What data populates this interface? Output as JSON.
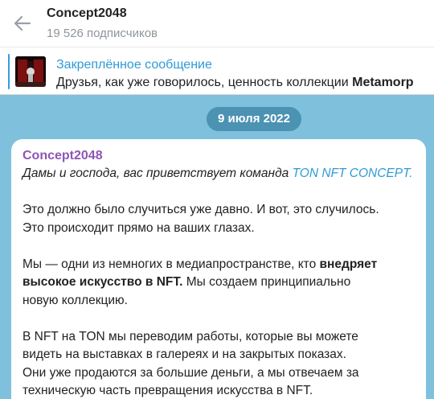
{
  "header": {
    "title": "Concept2048",
    "subscribers": "19 526 подписчиков",
    "back_icon": "arrow-left-icon"
  },
  "pinned": {
    "title": "Закреплённое сообщение",
    "text_prefix": "Друзья, как уже говорилось, ценность коллекции ",
    "text_bold": "Metamorp",
    "accent": "#3a9bdc"
  },
  "chat": {
    "background": "#7fc1dc",
    "date": "9 июля 2022"
  },
  "message": {
    "sender": "Concept2048",
    "greeting_prefix": "Дамы и господа, вас приветствует команда ",
    "greeting_link": "TON NFT CONCEPT.",
    "p1_l1": "Это должно было случиться уже давно. И вот, это случилось.",
    "p1_l2": "Это происходит прямо на ваших глазах.",
    "p2_l1_prefix": "Мы — одни из немногих в медиапространстве, кто ",
    "p2_l1_bold": "внедряет",
    "p2_l2_bold": "высокое искусство в NFT.",
    "p2_l2_rest": " Мы создаем принципиально",
    "p2_l3": "новую коллекцию.",
    "p3_l1": "В NFT на TON мы переводим работы, которые вы можете",
    "p3_l2": "видеть на выставках в галереях и на закрытых показах.",
    "p3_l3": "Они уже продаются за большие деньги, а мы отвечаем за",
    "p3_l4": "техническую часть превращения искусства в NFT."
  }
}
